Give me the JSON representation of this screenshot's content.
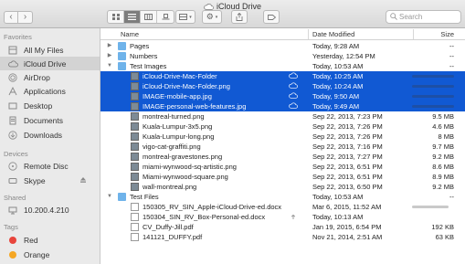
{
  "window": {
    "title": "iCloud Drive"
  },
  "toolbar": {
    "back_icon": "chevron-left-icon",
    "forward_icon": "chevron-right-icon",
    "search_placeholder": "Search"
  },
  "sidebar": {
    "favorites_label": "Favorites",
    "favorites": [
      {
        "label": "All My Files",
        "icon": "all-files-icon"
      },
      {
        "label": "iCloud Drive",
        "icon": "cloud-icon",
        "selected": true
      },
      {
        "label": "AirDrop",
        "icon": "airdrop-icon"
      },
      {
        "label": "Applications",
        "icon": "applications-icon"
      },
      {
        "label": "Desktop",
        "icon": "desktop-icon"
      },
      {
        "label": "Documents",
        "icon": "documents-icon"
      },
      {
        "label": "Downloads",
        "icon": "downloads-icon"
      }
    ],
    "devices_label": "Devices",
    "devices": [
      {
        "label": "Remote Disc",
        "icon": "disc-icon"
      },
      {
        "label": "Skype",
        "icon": "disk-icon",
        "eject": true
      }
    ],
    "shared_label": "Shared",
    "shared": [
      {
        "label": "10.200.4.210",
        "icon": "network-icon"
      }
    ],
    "tags_label": "Tags",
    "tags": [
      {
        "label": "Red",
        "color": "#e8453c"
      },
      {
        "label": "Orange",
        "color": "#f5a623"
      }
    ]
  },
  "columns": {
    "name": "Name",
    "date": "Date Modified",
    "size": "Size"
  },
  "rows": [
    {
      "disc": "▶",
      "indent": 0,
      "type": "folder",
      "name": "Pages",
      "date": "Today, 9:28 AM",
      "size": "--"
    },
    {
      "disc": "▶",
      "indent": 0,
      "type": "folder",
      "name": "Numbers",
      "date": "Yesterday, 12:54 PM",
      "size": "--"
    },
    {
      "disc": "▼",
      "indent": 0,
      "type": "folder",
      "name": "Test Images",
      "date": "Today, 10:53 AM",
      "size": "--"
    },
    {
      "indent": 1,
      "type": "img",
      "name": "iCloud-Drive-Mac-Folder",
      "date": "Today, 10:25 AM",
      "cloud": true,
      "selected": true,
      "bar": true
    },
    {
      "indent": 1,
      "type": "img",
      "name": "iCloud-Drive-Mac-Folder.png",
      "date": "Today, 10:24 AM",
      "cloud": true,
      "selected": true,
      "bar": true
    },
    {
      "indent": 1,
      "type": "img",
      "name": "IMAGE-mobile-app.jpg",
      "date": "Today, 9:50 AM",
      "cloud": true,
      "selected": true,
      "bar": true
    },
    {
      "indent": 1,
      "type": "img",
      "name": "IMAGE-personal-web-features.jpg",
      "date": "Today, 9:49 AM",
      "cloud": true,
      "selected": true,
      "bar": true
    },
    {
      "indent": 1,
      "type": "img",
      "name": "montreal-turned.png",
      "date": "Sep 22, 2013, 7:23 PM",
      "size": "9.5 MB"
    },
    {
      "indent": 1,
      "type": "img",
      "name": "Kuala-Lumpur-3x5.png",
      "date": "Sep 22, 2013, 7:26 PM",
      "size": "4.6 MB"
    },
    {
      "indent": 1,
      "type": "img",
      "name": "Kuala-Lumpur-long.png",
      "date": "Sep 22, 2013, 7:26 PM",
      "size": "8 MB"
    },
    {
      "indent": 1,
      "type": "img",
      "name": "vigo-cat-graffiti.png",
      "date": "Sep 22, 2013, 7:16 PM",
      "size": "9.7 MB"
    },
    {
      "indent": 1,
      "type": "img",
      "name": "montreal-gravestones.png",
      "date": "Sep 22, 2013, 7:27 PM",
      "size": "9.2 MB"
    },
    {
      "indent": 1,
      "type": "img",
      "name": "miami-wynwood-sq-artistic.png",
      "date": "Sep 22, 2013, 6:51 PM",
      "size": "8.6 MB"
    },
    {
      "indent": 1,
      "type": "img",
      "name": "Miami-wynwood-square.png",
      "date": "Sep 22, 2013, 6:51 PM",
      "size": "8.9 MB"
    },
    {
      "indent": 1,
      "type": "img",
      "name": "wall-montreal.png",
      "date": "Sep 22, 2013, 6:50 PM",
      "size": "9.2 MB"
    },
    {
      "disc": "▼",
      "indent": 0,
      "type": "folder",
      "name": "Test Files",
      "date": "Today, 10:53 AM",
      "size": "--"
    },
    {
      "indent": 1,
      "type": "doc",
      "name": "150305_RV_SIN_Apple-iCloud-Drive-ed.docx",
      "date": "Mar 6, 2015, 11:52 AM",
      "greybar": true
    },
    {
      "indent": 1,
      "type": "doc",
      "name": "150304_SIN_RV_Box-Personal-ed.docx",
      "date": "Today, 10:13 AM",
      "upload": true
    },
    {
      "indent": 1,
      "type": "doc",
      "name": "CV_Duffy-Jill.pdf",
      "date": "Jan 19, 2015, 6:54 PM",
      "size": "192 KB"
    },
    {
      "indent": 1,
      "type": "doc",
      "name": "141121_DUFFY.pdf",
      "date": "Nov 21, 2014, 2:51 AM",
      "size": "63 KB"
    }
  ]
}
